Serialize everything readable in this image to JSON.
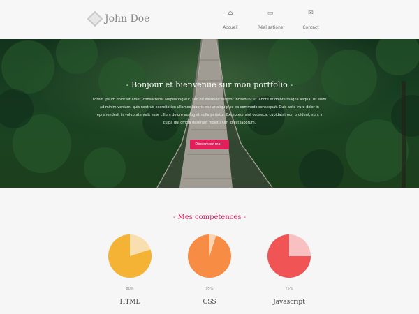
{
  "header": {
    "logo_text": "John Doe",
    "nav": [
      {
        "icon": "home-icon",
        "glyph": "⌂",
        "label": "Accueil"
      },
      {
        "icon": "folder-open-icon",
        "glyph": "▭",
        "label": "Réalisations"
      },
      {
        "icon": "mail-icon",
        "glyph": "✉",
        "label": "Contact"
      }
    ]
  },
  "hero": {
    "title": "- Bonjour et bienvenue sur mon portfolio -",
    "text": "Lorem ipsum dolor sit amet, consectetur adipisicing elit, sed do eiusmod tempor incididunt ut labore et dolore magna aliqua. Ut enim ad minim veniam, quis nostrud exercitation ullamco laboris nisi ut aliquip ex ea commodo consequat. Duis aute irure dolor in reprehenderit in voluptate velit esse cillum dolore eu fugiat nulla pariatur. Excepteur sint occaecat cupidatat non proident, sunt in culpa qui officia deserunt mollit anim id est laborum.",
    "button": "Découvrez-moi !"
  },
  "skills": {
    "title": "- Mes compétences -",
    "items": [
      {
        "name": "HTML",
        "percent": 80,
        "percent_label": "80%",
        "color": "#f5b335",
        "track": "#f9dfb0"
      },
      {
        "name": "CSS",
        "percent": 95,
        "percent_label": "95%",
        "color": "#f78d45",
        "track": "#fbd4b4"
      },
      {
        "name": "Javascript",
        "percent": 75,
        "percent_label": "75%",
        "color": "#f05454",
        "track": "#f8c0c0"
      }
    ]
  },
  "colors": {
    "accent": "#e0245e",
    "button": "#e21f5b"
  }
}
